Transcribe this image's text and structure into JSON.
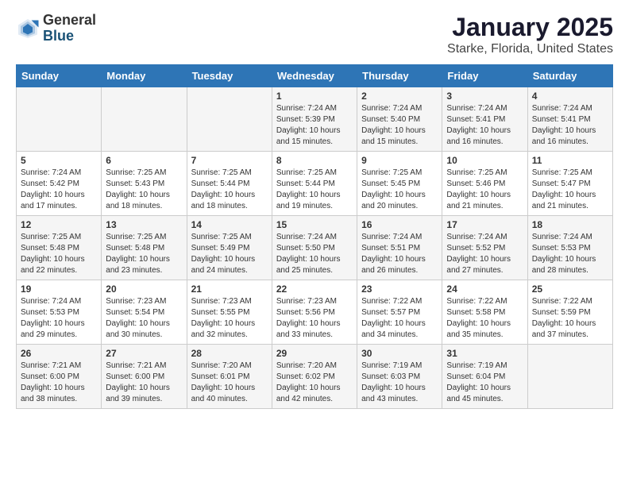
{
  "header": {
    "logo_general": "General",
    "logo_blue": "Blue",
    "title": "January 2025",
    "subtitle": "Starke, Florida, United States"
  },
  "calendar": {
    "headers": [
      "Sunday",
      "Monday",
      "Tuesday",
      "Wednesday",
      "Thursday",
      "Friday",
      "Saturday"
    ],
    "rows": [
      [
        {
          "day": "",
          "info": ""
        },
        {
          "day": "",
          "info": ""
        },
        {
          "day": "",
          "info": ""
        },
        {
          "day": "1",
          "info": "Sunrise: 7:24 AM\nSunset: 5:39 PM\nDaylight: 10 hours\nand 15 minutes."
        },
        {
          "day": "2",
          "info": "Sunrise: 7:24 AM\nSunset: 5:40 PM\nDaylight: 10 hours\nand 15 minutes."
        },
        {
          "day": "3",
          "info": "Sunrise: 7:24 AM\nSunset: 5:41 PM\nDaylight: 10 hours\nand 16 minutes."
        },
        {
          "day": "4",
          "info": "Sunrise: 7:24 AM\nSunset: 5:41 PM\nDaylight: 10 hours\nand 16 minutes."
        }
      ],
      [
        {
          "day": "5",
          "info": "Sunrise: 7:24 AM\nSunset: 5:42 PM\nDaylight: 10 hours\nand 17 minutes."
        },
        {
          "day": "6",
          "info": "Sunrise: 7:25 AM\nSunset: 5:43 PM\nDaylight: 10 hours\nand 18 minutes."
        },
        {
          "day": "7",
          "info": "Sunrise: 7:25 AM\nSunset: 5:44 PM\nDaylight: 10 hours\nand 18 minutes."
        },
        {
          "day": "8",
          "info": "Sunrise: 7:25 AM\nSunset: 5:44 PM\nDaylight: 10 hours\nand 19 minutes."
        },
        {
          "day": "9",
          "info": "Sunrise: 7:25 AM\nSunset: 5:45 PM\nDaylight: 10 hours\nand 20 minutes."
        },
        {
          "day": "10",
          "info": "Sunrise: 7:25 AM\nSunset: 5:46 PM\nDaylight: 10 hours\nand 21 minutes."
        },
        {
          "day": "11",
          "info": "Sunrise: 7:25 AM\nSunset: 5:47 PM\nDaylight: 10 hours\nand 21 minutes."
        }
      ],
      [
        {
          "day": "12",
          "info": "Sunrise: 7:25 AM\nSunset: 5:48 PM\nDaylight: 10 hours\nand 22 minutes."
        },
        {
          "day": "13",
          "info": "Sunrise: 7:25 AM\nSunset: 5:48 PM\nDaylight: 10 hours\nand 23 minutes."
        },
        {
          "day": "14",
          "info": "Sunrise: 7:25 AM\nSunset: 5:49 PM\nDaylight: 10 hours\nand 24 minutes."
        },
        {
          "day": "15",
          "info": "Sunrise: 7:24 AM\nSunset: 5:50 PM\nDaylight: 10 hours\nand 25 minutes."
        },
        {
          "day": "16",
          "info": "Sunrise: 7:24 AM\nSunset: 5:51 PM\nDaylight: 10 hours\nand 26 minutes."
        },
        {
          "day": "17",
          "info": "Sunrise: 7:24 AM\nSunset: 5:52 PM\nDaylight: 10 hours\nand 27 minutes."
        },
        {
          "day": "18",
          "info": "Sunrise: 7:24 AM\nSunset: 5:53 PM\nDaylight: 10 hours\nand 28 minutes."
        }
      ],
      [
        {
          "day": "19",
          "info": "Sunrise: 7:24 AM\nSunset: 5:53 PM\nDaylight: 10 hours\nand 29 minutes."
        },
        {
          "day": "20",
          "info": "Sunrise: 7:23 AM\nSunset: 5:54 PM\nDaylight: 10 hours\nand 30 minutes."
        },
        {
          "day": "21",
          "info": "Sunrise: 7:23 AM\nSunset: 5:55 PM\nDaylight: 10 hours\nand 32 minutes."
        },
        {
          "day": "22",
          "info": "Sunrise: 7:23 AM\nSunset: 5:56 PM\nDaylight: 10 hours\nand 33 minutes."
        },
        {
          "day": "23",
          "info": "Sunrise: 7:22 AM\nSunset: 5:57 PM\nDaylight: 10 hours\nand 34 minutes."
        },
        {
          "day": "24",
          "info": "Sunrise: 7:22 AM\nSunset: 5:58 PM\nDaylight: 10 hours\nand 35 minutes."
        },
        {
          "day": "25",
          "info": "Sunrise: 7:22 AM\nSunset: 5:59 PM\nDaylight: 10 hours\nand 37 minutes."
        }
      ],
      [
        {
          "day": "26",
          "info": "Sunrise: 7:21 AM\nSunset: 6:00 PM\nDaylight: 10 hours\nand 38 minutes."
        },
        {
          "day": "27",
          "info": "Sunrise: 7:21 AM\nSunset: 6:00 PM\nDaylight: 10 hours\nand 39 minutes."
        },
        {
          "day": "28",
          "info": "Sunrise: 7:20 AM\nSunset: 6:01 PM\nDaylight: 10 hours\nand 40 minutes."
        },
        {
          "day": "29",
          "info": "Sunrise: 7:20 AM\nSunset: 6:02 PM\nDaylight: 10 hours\nand 42 minutes."
        },
        {
          "day": "30",
          "info": "Sunrise: 7:19 AM\nSunset: 6:03 PM\nDaylight: 10 hours\nand 43 minutes."
        },
        {
          "day": "31",
          "info": "Sunrise: 7:19 AM\nSunset: 6:04 PM\nDaylight: 10 hours\nand 45 minutes."
        },
        {
          "day": "",
          "info": ""
        }
      ]
    ]
  }
}
